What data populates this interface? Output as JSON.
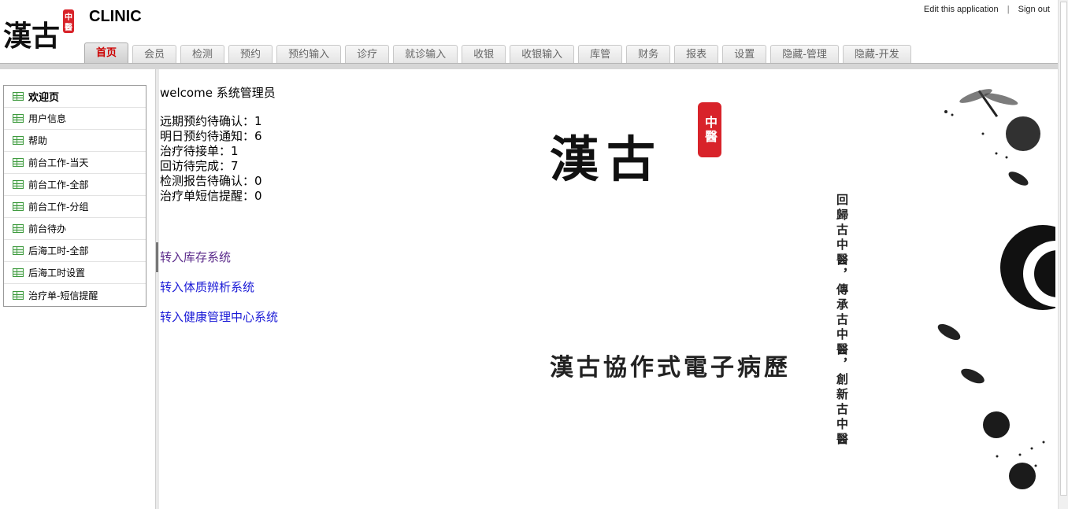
{
  "header": {
    "app_title": "CLINIC",
    "logo_text": "漢古",
    "logo_seal": "中醫",
    "edit_link": "Edit this application",
    "separator": "|",
    "signout_link": "Sign out"
  },
  "tabs": [
    {
      "label": "首页",
      "active": true
    },
    {
      "label": "会员"
    },
    {
      "label": "检测"
    },
    {
      "label": "预约"
    },
    {
      "label": "预约输入"
    },
    {
      "label": "诊疗"
    },
    {
      "label": "就诊输入"
    },
    {
      "label": "收银"
    },
    {
      "label": "收银输入"
    },
    {
      "label": "库管"
    },
    {
      "label": "财务"
    },
    {
      "label": "报表"
    },
    {
      "label": "设置"
    },
    {
      "label": "隐藏-管理"
    },
    {
      "label": "隐藏-开发"
    }
  ],
  "sidebar": {
    "items": [
      {
        "label": "欢迎页",
        "active": true
      },
      {
        "label": "用户信息"
      },
      {
        "label": "帮助"
      },
      {
        "label": "前台工作-当天"
      },
      {
        "label": "前台工作-全部"
      },
      {
        "label": "前台工作-分组"
      },
      {
        "label": "前台待办"
      },
      {
        "label": "后海工时-全部"
      },
      {
        "label": "后海工时设置"
      },
      {
        "label": "治疗单-短信提醒"
      }
    ]
  },
  "main": {
    "welcome": "welcome 系统管理员",
    "stats": [
      "远期预约待确认：1",
      "明日预约待通知：6",
      "治疗待接单：1",
      "回访待完成：7",
      "检测报告待确认：0",
      "治疗单短信提醒：0"
    ],
    "links": {
      "inventory": "转入库存系统",
      "constitution": "转入体质辨析系统",
      "health": "转入健康管理中心系统"
    },
    "hero": {
      "title": "漢古",
      "seal": "中醫",
      "subtitle": "漢古協作式電子病歷",
      "vertical_lines": "回歸古中醫，傳承古中醫，創新古中醫"
    }
  }
}
